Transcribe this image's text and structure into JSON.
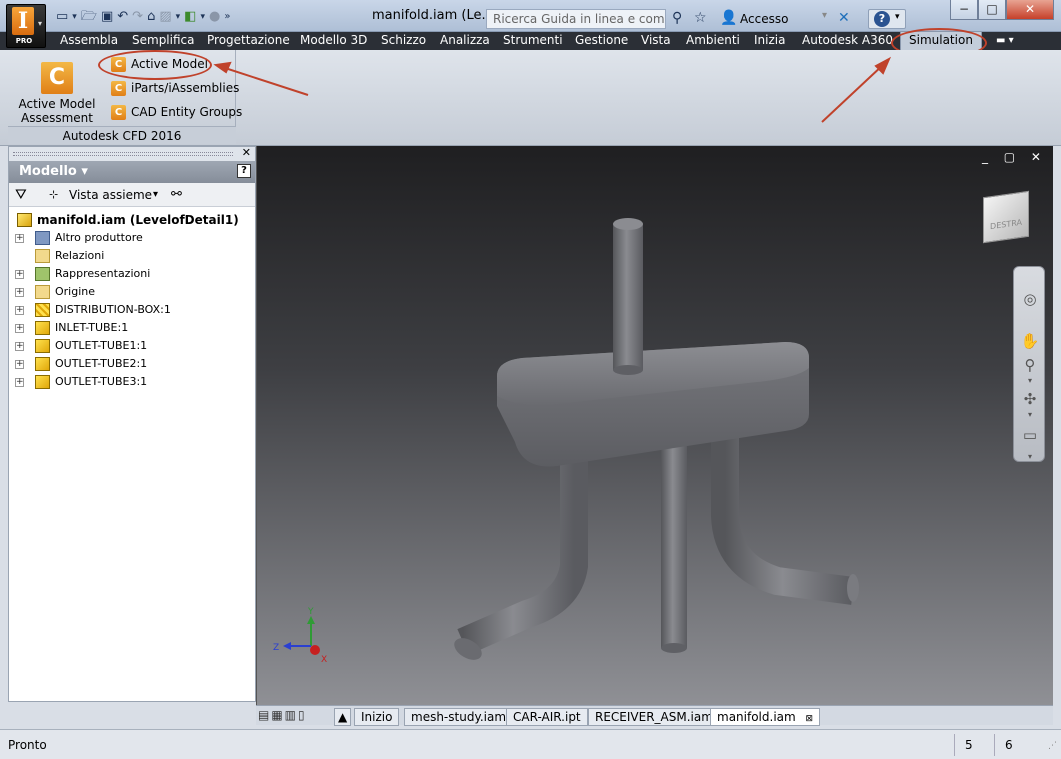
{
  "window": {
    "document_title": "manifold.iam (Le...",
    "minimize_label": "−",
    "maximize_label": "□",
    "close_label": "✕"
  },
  "app_button": {
    "badge": "PRO"
  },
  "search": {
    "placeholder": "Ricerca Guida in linea e comand"
  },
  "login": {
    "label": "Accesso"
  },
  "help": {
    "label": "?"
  },
  "menu": {
    "tabs": [
      "Assembla",
      "Semplifica",
      "Progettazione",
      "Modello 3D",
      "Schizzo",
      "Analizza",
      "Strumenti",
      "Gestione",
      "Vista",
      "Ambienti",
      "Inizia",
      "Autodesk A360",
      "Simulation"
    ],
    "active": "Simulation"
  },
  "ribbon": {
    "panel_title": "Autodesk CFD 2016",
    "assessment_tool_label": "Active Model Assessment Tool",
    "buttons": [
      "Active Model",
      "iParts/iAssemblies",
      "CAD Entity Groups"
    ]
  },
  "browser": {
    "title": "Modello ▾",
    "view_label": "Vista assieme",
    "root": "manifold.iam (LevelofDetail1)",
    "items": [
      {
        "label": "Altro produttore",
        "icon": "third-party-icon",
        "expandable": true
      },
      {
        "label": "Relazioni",
        "icon": "folder-icon",
        "expandable": false
      },
      {
        "label": "Rappresentazioni",
        "icon": "representations-icon",
        "expandable": true
      },
      {
        "label": "Origine",
        "icon": "folder-icon",
        "expandable": true
      },
      {
        "label": "DISTRIBUTION-BOX:1",
        "icon": "suppressed-part-icon",
        "expandable": true
      },
      {
        "label": "INLET-TUBE:1",
        "icon": "part-icon",
        "expandable": true
      },
      {
        "label": "OUTLET-TUBE1:1",
        "icon": "part-icon",
        "expandable": true
      },
      {
        "label": "OUTLET-TUBE2:1",
        "icon": "part-icon",
        "expandable": true
      },
      {
        "label": "OUTLET-TUBE3:1",
        "icon": "part-icon",
        "expandable": true
      }
    ]
  },
  "viewport": {
    "viewcube_face": "DESTRA",
    "axis_labels": {
      "x": "X",
      "y": "Y",
      "z": "Z"
    }
  },
  "doc_tabs": [
    "Inizio",
    "mesh-study.iam",
    "CAR-AIR.ipt",
    "RECEIVER_ASM.iam",
    "manifold.iam"
  ],
  "doc_tabs_active": "manifold.iam",
  "status": {
    "text": "Pronto",
    "num1": "5",
    "num2": "6"
  },
  "colors": {
    "annotation": "#c0422b",
    "menubar": "#2b2f36",
    "model": "#6f7075"
  }
}
